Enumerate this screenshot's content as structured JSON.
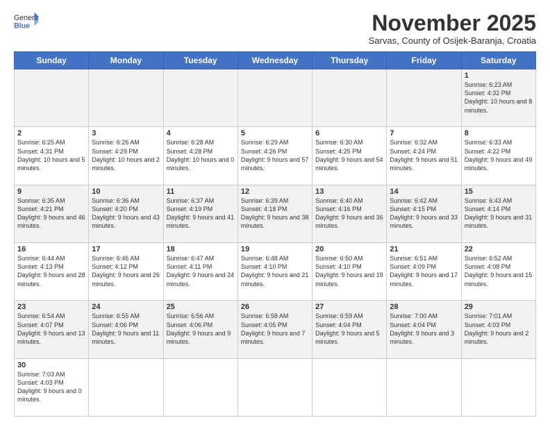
{
  "logo": {
    "text_general": "General",
    "text_blue": "Blue"
  },
  "header": {
    "month": "November 2025",
    "subtitle": "Sarvas, County of Osijek-Baranja, Croatia"
  },
  "weekdays": [
    "Sunday",
    "Monday",
    "Tuesday",
    "Wednesday",
    "Thursday",
    "Friday",
    "Saturday"
  ],
  "weeks": [
    [
      {
        "date": "",
        "info": ""
      },
      {
        "date": "",
        "info": ""
      },
      {
        "date": "",
        "info": ""
      },
      {
        "date": "",
        "info": ""
      },
      {
        "date": "",
        "info": ""
      },
      {
        "date": "",
        "info": ""
      },
      {
        "date": "1",
        "info": "Sunrise: 6:23 AM\nSunset: 4:32 PM\nDaylight: 10 hours and 8 minutes."
      }
    ],
    [
      {
        "date": "2",
        "info": "Sunrise: 6:25 AM\nSunset: 4:31 PM\nDaylight: 10 hours and 5 minutes."
      },
      {
        "date": "3",
        "info": "Sunrise: 6:26 AM\nSunset: 4:29 PM\nDaylight: 10 hours and 2 minutes."
      },
      {
        "date": "4",
        "info": "Sunrise: 6:28 AM\nSunset: 4:28 PM\nDaylight: 10 hours and 0 minutes."
      },
      {
        "date": "5",
        "info": "Sunrise: 6:29 AM\nSunset: 4:26 PM\nDaylight: 9 hours and 57 minutes."
      },
      {
        "date": "6",
        "info": "Sunrise: 6:30 AM\nSunset: 4:25 PM\nDaylight: 9 hours and 54 minutes."
      },
      {
        "date": "7",
        "info": "Sunrise: 6:32 AM\nSunset: 4:24 PM\nDaylight: 9 hours and 51 minutes."
      },
      {
        "date": "8",
        "info": "Sunrise: 6:33 AM\nSunset: 4:22 PM\nDaylight: 9 hours and 49 minutes."
      }
    ],
    [
      {
        "date": "9",
        "info": "Sunrise: 6:35 AM\nSunset: 4:21 PM\nDaylight: 9 hours and 46 minutes."
      },
      {
        "date": "10",
        "info": "Sunrise: 6:36 AM\nSunset: 4:20 PM\nDaylight: 9 hours and 43 minutes."
      },
      {
        "date": "11",
        "info": "Sunrise: 6:37 AM\nSunset: 4:19 PM\nDaylight: 9 hours and 41 minutes."
      },
      {
        "date": "12",
        "info": "Sunrise: 6:39 AM\nSunset: 4:18 PM\nDaylight: 9 hours and 38 minutes."
      },
      {
        "date": "13",
        "info": "Sunrise: 6:40 AM\nSunset: 4:16 PM\nDaylight: 9 hours and 36 minutes."
      },
      {
        "date": "14",
        "info": "Sunrise: 6:42 AM\nSunset: 4:15 PM\nDaylight: 9 hours and 33 minutes."
      },
      {
        "date": "15",
        "info": "Sunrise: 6:43 AM\nSunset: 4:14 PM\nDaylight: 9 hours and 31 minutes."
      }
    ],
    [
      {
        "date": "16",
        "info": "Sunrise: 6:44 AM\nSunset: 4:13 PM\nDaylight: 9 hours and 28 minutes."
      },
      {
        "date": "17",
        "info": "Sunrise: 6:46 AM\nSunset: 4:12 PM\nDaylight: 9 hours and 26 minutes."
      },
      {
        "date": "18",
        "info": "Sunrise: 6:47 AM\nSunset: 4:11 PM\nDaylight: 9 hours and 24 minutes."
      },
      {
        "date": "19",
        "info": "Sunrise: 6:48 AM\nSunset: 4:10 PM\nDaylight: 9 hours and 21 minutes."
      },
      {
        "date": "20",
        "info": "Sunrise: 6:50 AM\nSunset: 4:10 PM\nDaylight: 9 hours and 19 minutes."
      },
      {
        "date": "21",
        "info": "Sunrise: 6:51 AM\nSunset: 4:09 PM\nDaylight: 9 hours and 17 minutes."
      },
      {
        "date": "22",
        "info": "Sunrise: 6:52 AM\nSunset: 4:08 PM\nDaylight: 9 hours and 15 minutes."
      }
    ],
    [
      {
        "date": "23",
        "info": "Sunrise: 6:54 AM\nSunset: 4:07 PM\nDaylight: 9 hours and 13 minutes."
      },
      {
        "date": "24",
        "info": "Sunrise: 6:55 AM\nSunset: 4:06 PM\nDaylight: 9 hours and 11 minutes."
      },
      {
        "date": "25",
        "info": "Sunrise: 6:56 AM\nSunset: 4:06 PM\nDaylight: 9 hours and 9 minutes."
      },
      {
        "date": "26",
        "info": "Sunrise: 6:58 AM\nSunset: 4:05 PM\nDaylight: 9 hours and 7 minutes."
      },
      {
        "date": "27",
        "info": "Sunrise: 6:59 AM\nSunset: 4:04 PM\nDaylight: 9 hours and 5 minutes."
      },
      {
        "date": "28",
        "info": "Sunrise: 7:00 AM\nSunset: 4:04 PM\nDaylight: 9 hours and 3 minutes."
      },
      {
        "date": "29",
        "info": "Sunrise: 7:01 AM\nSunset: 4:03 PM\nDaylight: 9 hours and 2 minutes."
      }
    ],
    [
      {
        "date": "30",
        "info": "Sunrise: 7:03 AM\nSunset: 4:03 PM\nDaylight: 9 hours and 0 minutes."
      },
      {
        "date": "",
        "info": ""
      },
      {
        "date": "",
        "info": ""
      },
      {
        "date": "",
        "info": ""
      },
      {
        "date": "",
        "info": ""
      },
      {
        "date": "",
        "info": ""
      },
      {
        "date": "",
        "info": ""
      }
    ]
  ]
}
